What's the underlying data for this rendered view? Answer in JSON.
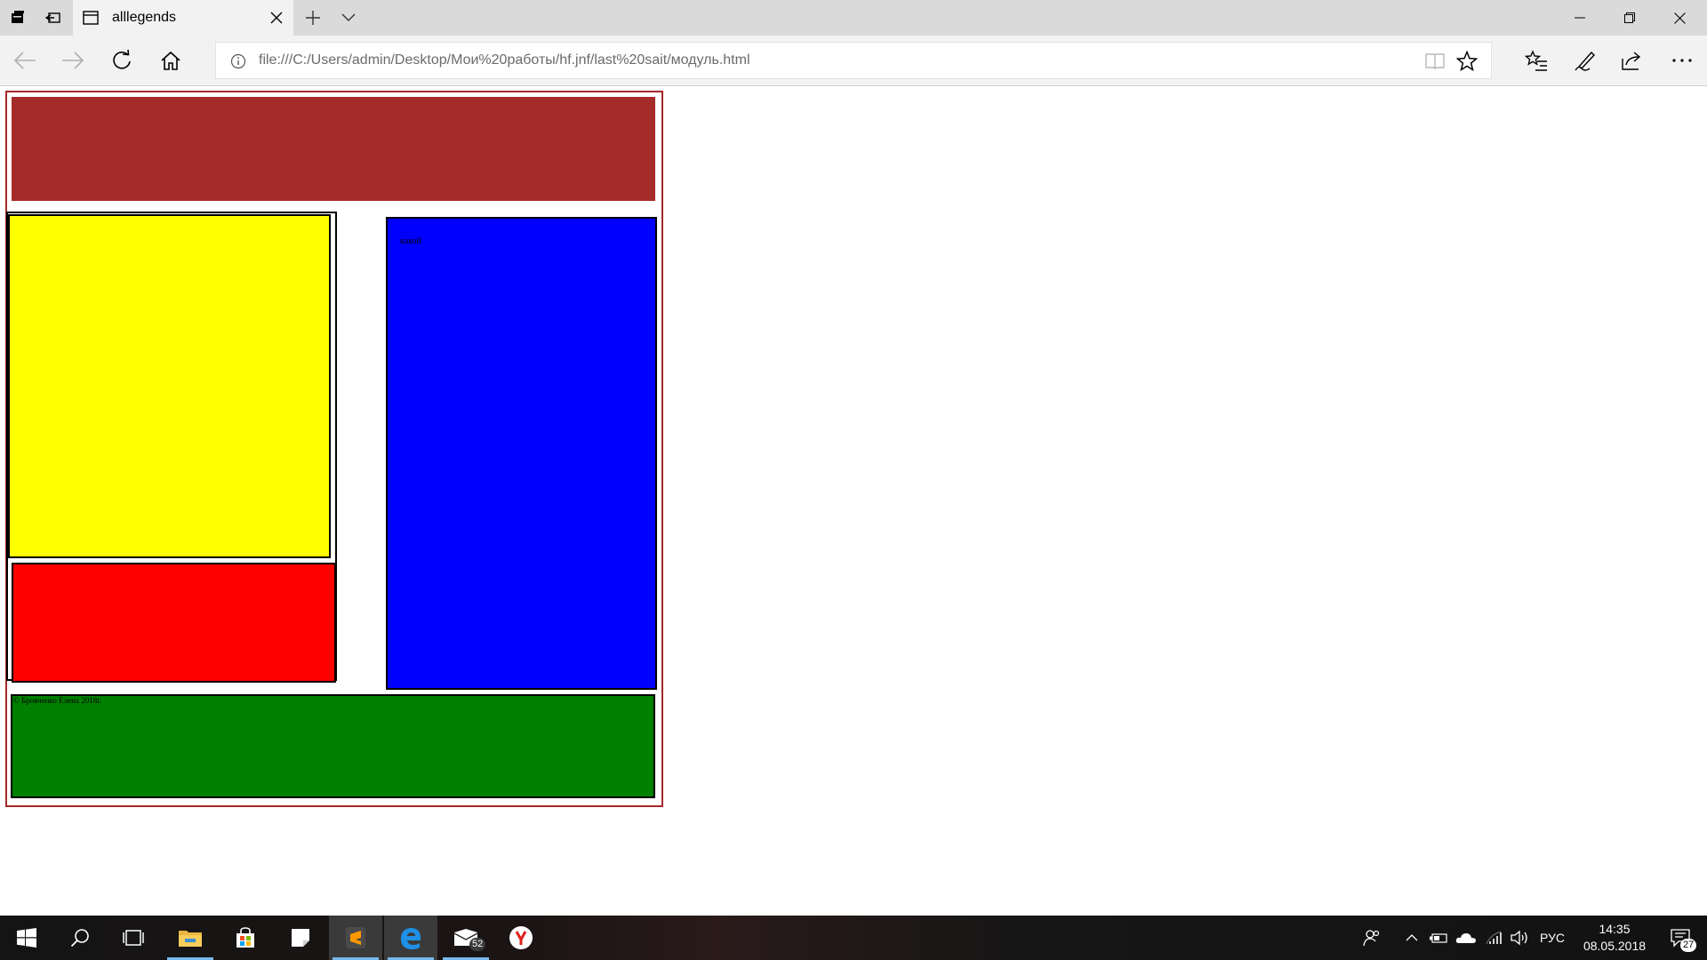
{
  "browser": {
    "tab": {
      "title": "alllegends"
    },
    "address": {
      "url": "file:///C:/Users/admin/Desktop/Мои%20работы/hf.jnf/last%20sait/модуль.html"
    }
  },
  "page": {
    "sidebar_text": "какой",
    "footer_text": "© Бровченко Елена 2018г.",
    "colors": {
      "header": "#a52a2a",
      "left_top": "#ffff00",
      "left_bottom": "#ff0000",
      "right": "#0000ff",
      "footer": "#008000"
    }
  },
  "taskbar": {
    "icons": [
      "windows-start-icon",
      "search-icon",
      "task-view-icon",
      "file-explorer-icon",
      "store-icon",
      "sticky-notes-icon",
      "sublime-text-icon",
      "edge-icon",
      "mail-icon",
      "yandex-browser-icon"
    ],
    "mail_badge": "52",
    "language": "РУС",
    "time": "14:35",
    "date": "08.05.2018",
    "notifications_badge": "27"
  }
}
